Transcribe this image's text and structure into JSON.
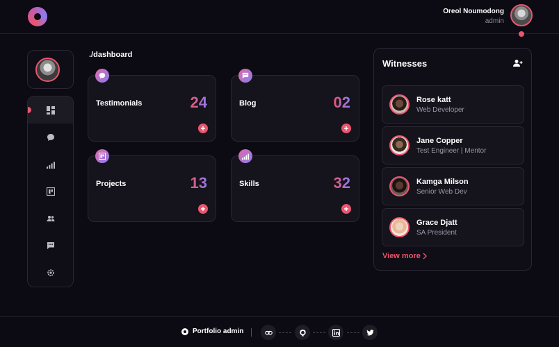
{
  "header": {
    "user_name": "Oreol Noumodong",
    "user_role": "admin"
  },
  "breadcrumb": "./dashboard",
  "sidebar": {
    "items": [
      {
        "icon": "dashboard-icon",
        "active": true
      },
      {
        "icon": "chat-bubble-icon",
        "active": false
      },
      {
        "icon": "signal-bars-icon",
        "active": false
      },
      {
        "icon": "projects-icon",
        "active": false
      },
      {
        "icon": "users-icon",
        "active": false
      },
      {
        "icon": "message-icon",
        "active": false
      },
      {
        "icon": "settings-icon",
        "active": false
      }
    ]
  },
  "cards": [
    {
      "label": "Testimonials",
      "count": "24",
      "icon": "chat-bubble-icon"
    },
    {
      "label": "Blog",
      "count": "02",
      "icon": "message-icon"
    },
    {
      "label": "Projects",
      "count": "13",
      "icon": "projects-icon"
    },
    {
      "label": "Skills",
      "count": "32",
      "icon": "signal-bars-icon"
    }
  ],
  "witnesses": {
    "title": "Witnesses",
    "items": [
      {
        "name": "Rose katt",
        "role": "Web Developer"
      },
      {
        "name": "Jane Copper",
        "role": "Test Engineer | Mentor"
      },
      {
        "name": "Kamga Milson",
        "role": "Senior Web Dev"
      },
      {
        "name": "Grace Djatt",
        "role": "SA President"
      }
    ],
    "view_more": "View more"
  },
  "footer": {
    "brand": "Portfolio admin",
    "socials": [
      "link-icon",
      "github-icon",
      "linkedin-icon",
      "twitter-icon"
    ]
  },
  "colors": {
    "accent": "#e9566f",
    "accent_secondary": "#8a7cf2",
    "background": "#0c0a12",
    "card": "#15131c"
  }
}
